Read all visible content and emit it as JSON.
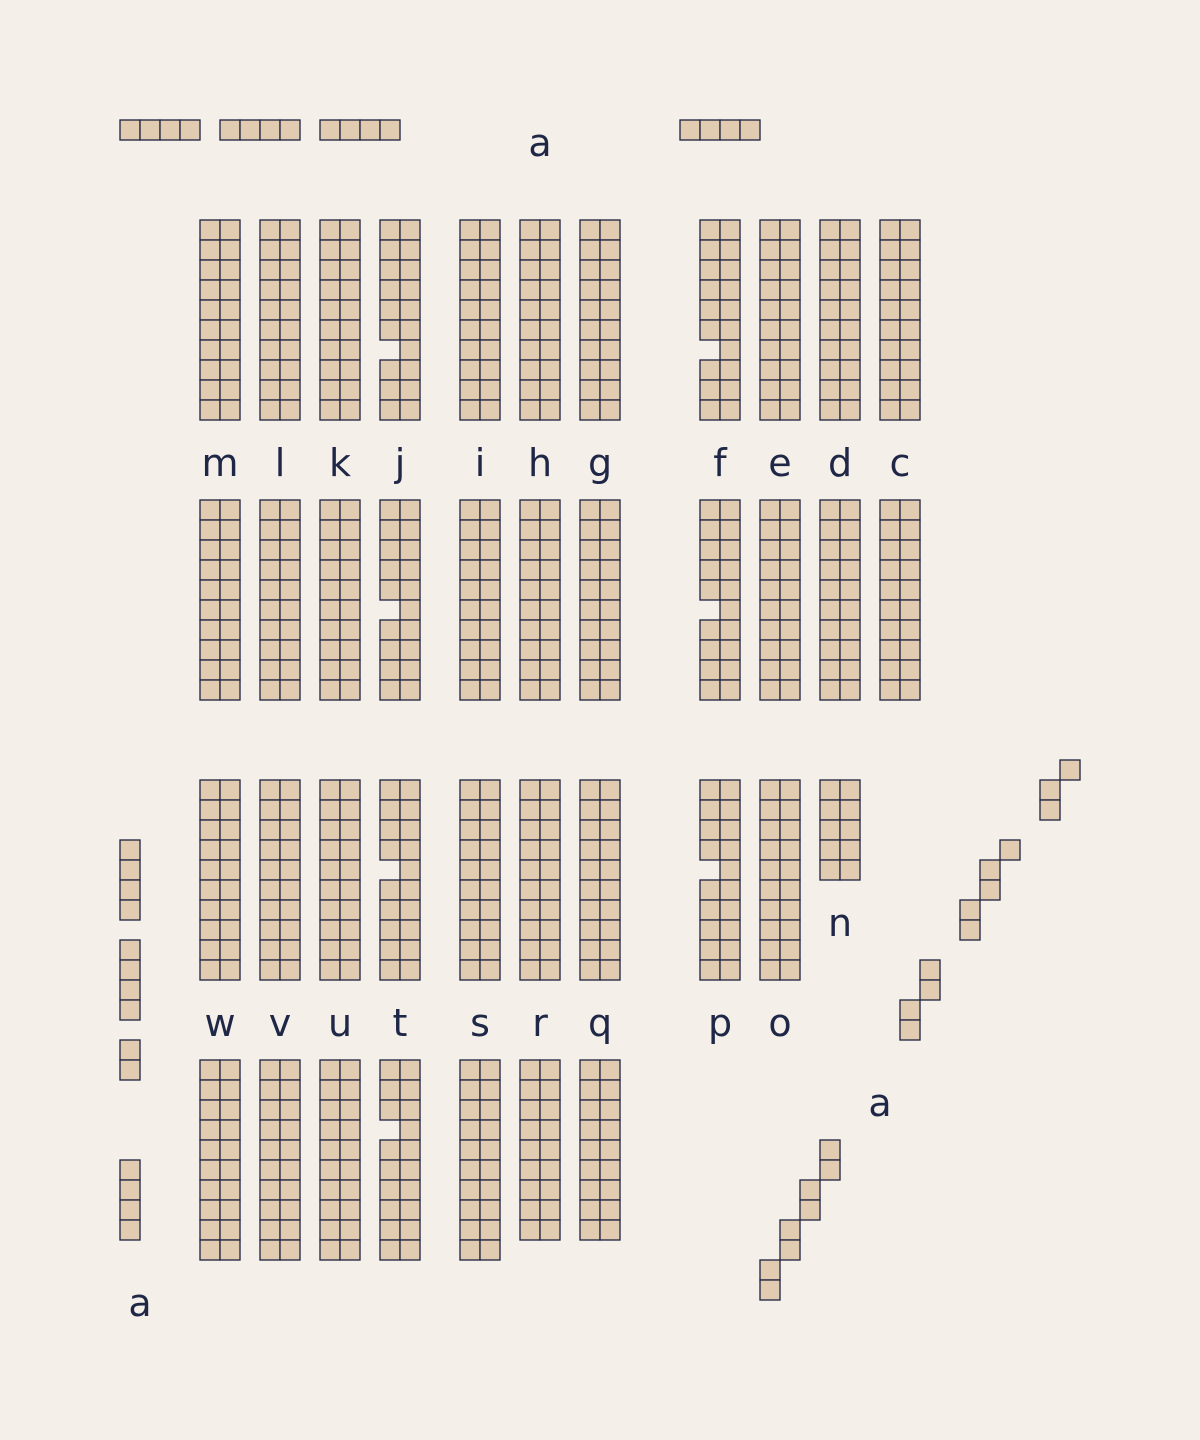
{
  "colors": {
    "background": "#f4efe8",
    "seat_fill": "#e2ccb1",
    "seat_outline": "#1b2140",
    "label_text": "#1f2747"
  },
  "labels": {
    "section_a_top": "a",
    "row_m": "m",
    "row_l": "l",
    "row_k": "k",
    "row_j": "j",
    "row_i": "i",
    "row_h": "h",
    "row_g": "g",
    "row_f": "f",
    "row_e": "e",
    "row_d": "d",
    "row_c": "c",
    "row_n": "n",
    "row_w": "w",
    "row_v": "v",
    "row_u": "u",
    "row_t": "t",
    "row_s": "s",
    "row_r": "r",
    "row_q": "q",
    "row_p": "p",
    "row_o": "o",
    "section_a_right": "a",
    "section_a_left": "a"
  }
}
